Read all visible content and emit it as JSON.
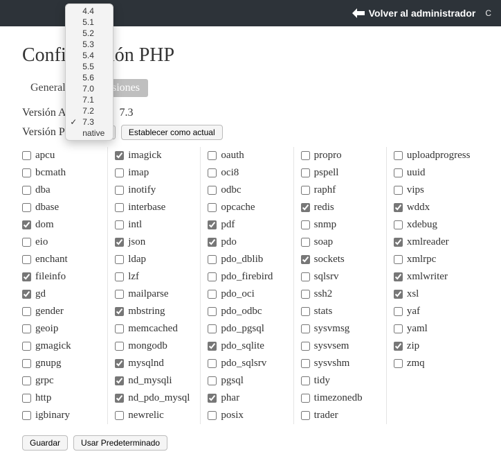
{
  "topbar": {
    "back_label": "Volver al administrador",
    "extra_label": "C"
  },
  "page": {
    "title": "Configuración PHP"
  },
  "tabs": {
    "general": "General",
    "extensions": "Extensiones"
  },
  "labels": {
    "current_version_label": "Versión Actual PHP:",
    "current_version_value": "7.3",
    "php_version_label": "Versión PHP",
    "set_current_button": "Establecer como actual",
    "save_button": "Guardar",
    "default_button": "Usar Predeterminado"
  },
  "dropdown": {
    "selected": "7.3",
    "options": [
      "4.4",
      "5.1",
      "5.2",
      "5.3",
      "5.4",
      "5.5",
      "5.6",
      "7.0",
      "7.1",
      "7.2",
      "7.3",
      "native"
    ]
  },
  "extensions": {
    "col1": [
      {
        "name": "apcu",
        "checked": false
      },
      {
        "name": "bcmath",
        "checked": false
      },
      {
        "name": "dba",
        "checked": false
      },
      {
        "name": "dbase",
        "checked": false
      },
      {
        "name": "dom",
        "checked": true
      },
      {
        "name": "eio",
        "checked": false
      },
      {
        "name": "enchant",
        "checked": false
      },
      {
        "name": "fileinfo",
        "checked": true
      },
      {
        "name": "gd",
        "checked": true
      },
      {
        "name": "gender",
        "checked": false
      },
      {
        "name": "geoip",
        "checked": false
      },
      {
        "name": "gmagick",
        "checked": false
      },
      {
        "name": "gnupg",
        "checked": false
      },
      {
        "name": "grpc",
        "checked": false
      },
      {
        "name": "http",
        "checked": false
      },
      {
        "name": "igbinary",
        "checked": false
      }
    ],
    "col2": [
      {
        "name": "imagick",
        "checked": true
      },
      {
        "name": "imap",
        "checked": false
      },
      {
        "name": "inotify",
        "checked": false
      },
      {
        "name": "interbase",
        "checked": false
      },
      {
        "name": "intl",
        "checked": false
      },
      {
        "name": "json",
        "checked": true
      },
      {
        "name": "ldap",
        "checked": false
      },
      {
        "name": "lzf",
        "checked": false
      },
      {
        "name": "mailparse",
        "checked": false
      },
      {
        "name": "mbstring",
        "checked": true
      },
      {
        "name": "memcached",
        "checked": false
      },
      {
        "name": "mongodb",
        "checked": false
      },
      {
        "name": "mysqlnd",
        "checked": true
      },
      {
        "name": "nd_mysqli",
        "checked": true
      },
      {
        "name": "nd_pdo_mysql",
        "checked": true
      },
      {
        "name": "newrelic",
        "checked": false
      }
    ],
    "col3": [
      {
        "name": "oauth",
        "checked": false
      },
      {
        "name": "oci8",
        "checked": false
      },
      {
        "name": "odbc",
        "checked": false
      },
      {
        "name": "opcache",
        "checked": false
      },
      {
        "name": "pdf",
        "checked": true
      },
      {
        "name": "pdo",
        "checked": true
      },
      {
        "name": "pdo_dblib",
        "checked": false
      },
      {
        "name": "pdo_firebird",
        "checked": false
      },
      {
        "name": "pdo_oci",
        "checked": false
      },
      {
        "name": "pdo_odbc",
        "checked": false
      },
      {
        "name": "pdo_pgsql",
        "checked": false
      },
      {
        "name": "pdo_sqlite",
        "checked": true
      },
      {
        "name": "pdo_sqlsrv",
        "checked": false
      },
      {
        "name": "pgsql",
        "checked": false
      },
      {
        "name": "phar",
        "checked": true
      },
      {
        "name": "posix",
        "checked": false
      }
    ],
    "col4": [
      {
        "name": "propro",
        "checked": false
      },
      {
        "name": "pspell",
        "checked": false
      },
      {
        "name": "raphf",
        "checked": false
      },
      {
        "name": "redis",
        "checked": true
      },
      {
        "name": "snmp",
        "checked": false
      },
      {
        "name": "soap",
        "checked": false
      },
      {
        "name": "sockets",
        "checked": true
      },
      {
        "name": "sqlsrv",
        "checked": false
      },
      {
        "name": "ssh2",
        "checked": false
      },
      {
        "name": "stats",
        "checked": false
      },
      {
        "name": "sysvmsg",
        "checked": false
      },
      {
        "name": "sysvsem",
        "checked": false
      },
      {
        "name": "sysvshm",
        "checked": false
      },
      {
        "name": "tidy",
        "checked": false
      },
      {
        "name": "timezonedb",
        "checked": false
      },
      {
        "name": "trader",
        "checked": false
      }
    ],
    "col5": [
      {
        "name": "uploadprogress",
        "checked": false
      },
      {
        "name": "uuid",
        "checked": false
      },
      {
        "name": "vips",
        "checked": false
      },
      {
        "name": "wddx",
        "checked": true
      },
      {
        "name": "xdebug",
        "checked": false
      },
      {
        "name": "xmlreader",
        "checked": true
      },
      {
        "name": "xmlrpc",
        "checked": false
      },
      {
        "name": "xmlwriter",
        "checked": true
      },
      {
        "name": "xsl",
        "checked": true
      },
      {
        "name": "yaf",
        "checked": false
      },
      {
        "name": "yaml",
        "checked": false
      },
      {
        "name": "zip",
        "checked": true
      },
      {
        "name": "zmq",
        "checked": false
      }
    ]
  }
}
